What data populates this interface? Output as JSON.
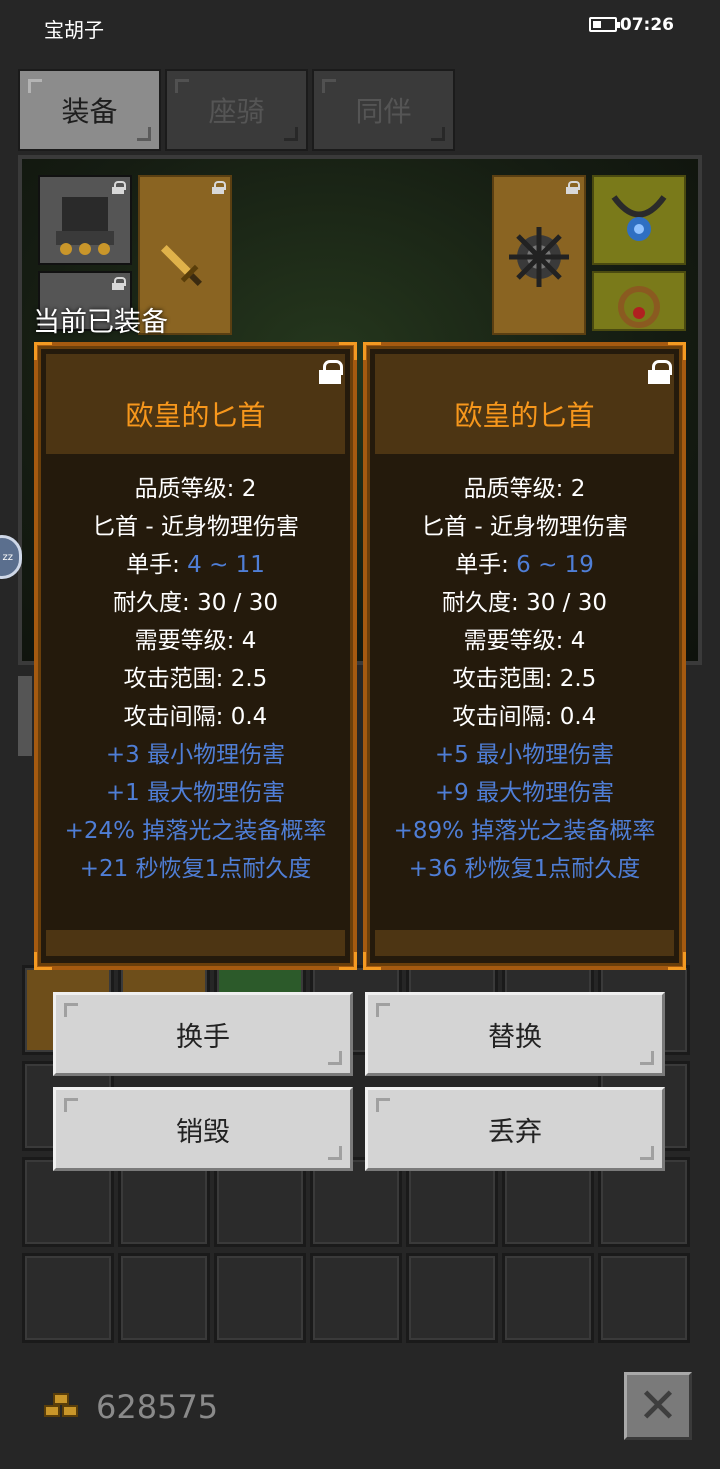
{
  "status_bar": {
    "app_name": "宝胡子",
    "time": "07:26"
  },
  "tabs": [
    {
      "label": "装备",
      "active": true
    },
    {
      "label": "座骑",
      "active": false
    },
    {
      "label": "同伴",
      "active": false
    }
  ],
  "current_label": "当前已装备",
  "cards": [
    {
      "title": "欧皇的匕首",
      "lines": [
        {
          "text": "品质等级: 2"
        },
        {
          "text": "匕首 - 近身物理伤害"
        },
        {
          "prefix": "单手: ",
          "value": "4 ~ 11"
        },
        {
          "text": "耐久度: 30 / 30"
        },
        {
          "text": "需要等级: 4"
        },
        {
          "text": "攻击范围: 2.5"
        },
        {
          "text": "攻击间隔: 0.4"
        },
        {
          "bonus": "+3 最小物理伤害"
        },
        {
          "bonus": "+1 最大物理伤害"
        },
        {
          "bonus": "+24% 掉落光之装备概率"
        },
        {
          "bonus": "+21 秒恢复1点耐久度"
        }
      ]
    },
    {
      "title": "欧皇的匕首",
      "lines": [
        {
          "text": "品质等级: 2"
        },
        {
          "text": "匕首 - 近身物理伤害"
        },
        {
          "prefix": "单手: ",
          "value": "6 ~ 19"
        },
        {
          "text": "耐久度: 30 / 30"
        },
        {
          "text": "需要等级: 4"
        },
        {
          "text": "攻击范围: 2.5"
        },
        {
          "text": "攻击间隔: 0.4"
        },
        {
          "bonus": "+5 最小物理伤害"
        },
        {
          "bonus": "+9 最大物理伤害"
        },
        {
          "bonus": "+89% 掉落光之装备概率"
        },
        {
          "bonus": "+36 秒恢复1点耐久度"
        }
      ]
    }
  ],
  "actions": {
    "swap_hand": "换手",
    "replace": "替换",
    "destroy": "销毁",
    "discard": "丢弃"
  },
  "gold": {
    "amount": "628575"
  },
  "colors": {
    "title_orange": "#f7971c",
    "bonus_blue": "#4f7ed6",
    "card_border": "#a55a10"
  }
}
